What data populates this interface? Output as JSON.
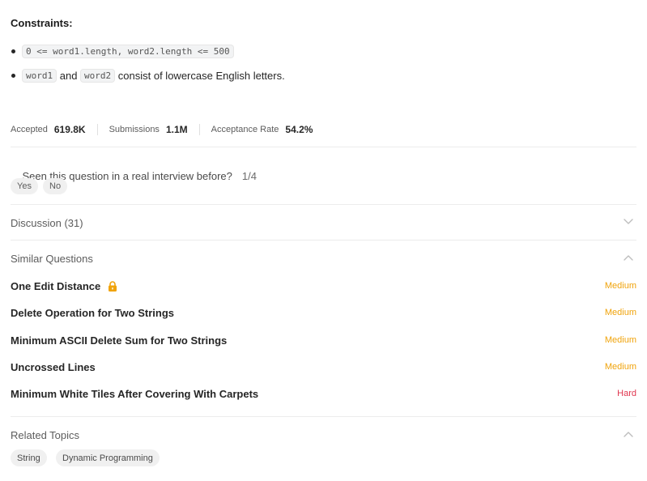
{
  "constraints": {
    "title": "Constraints:",
    "item1": {
      "code": "0 <= word1.length, word2.length <= 500"
    },
    "item2": {
      "code_a": "word1",
      "text_a": " and ",
      "code_b": "word2",
      "text_b": " consist of lowercase English letters."
    }
  },
  "stats": {
    "accepted_label": "Accepted",
    "accepted_value": "619.8K",
    "submissions_label": "Submissions",
    "submissions_value": "1.1M",
    "rate_label": "Acceptance Rate",
    "rate_value": "54.2%"
  },
  "interview": {
    "question": "Seen this question in a real interview before?",
    "count": "1/4",
    "yes_label": "Yes",
    "no_label": "No"
  },
  "discussion": {
    "label": "Discussion (31)",
    "icon": "chevron-down-icon"
  },
  "similar": {
    "label": "Similar Questions",
    "icon": "chevron-up-icon",
    "items": [
      {
        "title": "One Edit Distance",
        "locked": true,
        "difficulty": "Medium"
      },
      {
        "title": "Delete Operation for Two Strings",
        "difficulty": "Medium"
      },
      {
        "title": "Minimum ASCII Delete Sum for Two Strings",
        "difficulty": "Medium"
      },
      {
        "title": "Uncrossed Lines",
        "difficulty": "Medium"
      },
      {
        "title": "Minimum White Tiles After Covering With Carpets",
        "difficulty": "Hard"
      }
    ],
    "colors": {
      "medium": "#f0a30a",
      "hard": "#e0364f",
      "lock": "#f0a30a"
    }
  },
  "related": {
    "label": "Related Topics",
    "icon": "chevron-up-icon",
    "tags": [
      "String",
      "Dynamic Programming"
    ]
  }
}
